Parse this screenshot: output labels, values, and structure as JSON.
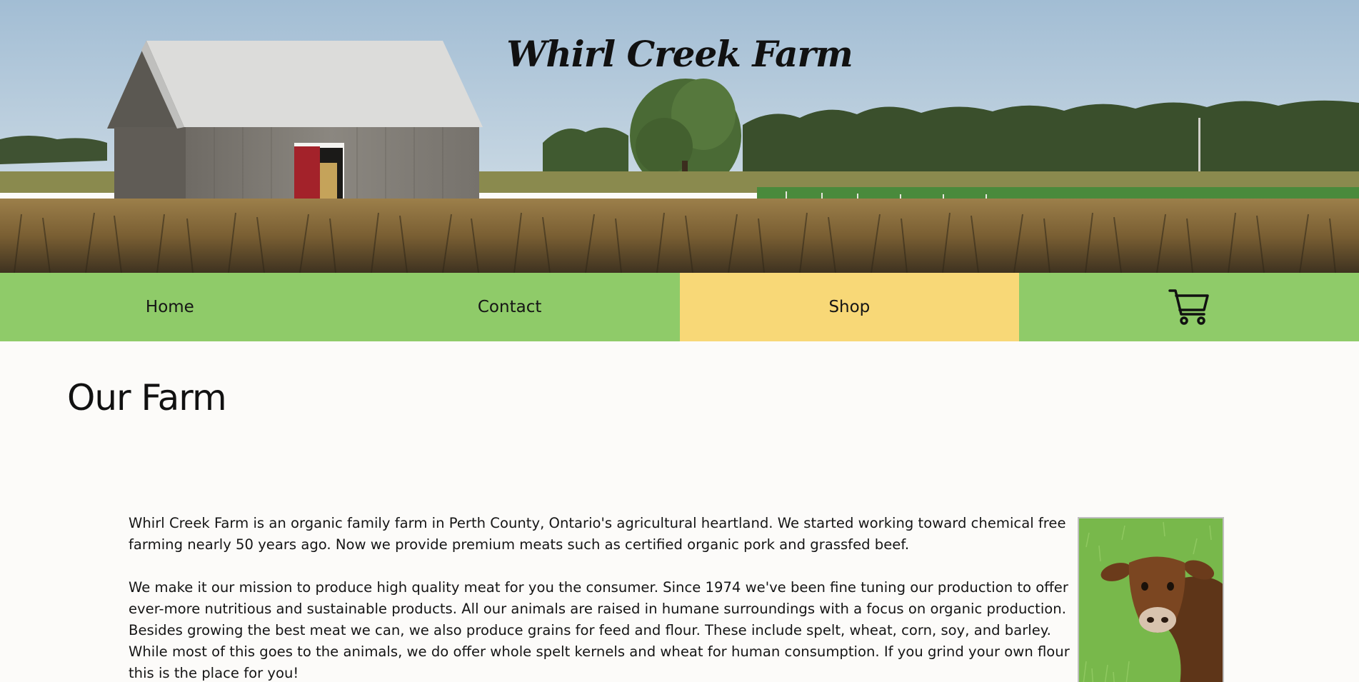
{
  "site": {
    "title": "Whirl Creek Farm"
  },
  "nav": {
    "items": [
      {
        "label": "Home",
        "active": false
      },
      {
        "label": "Contact",
        "active": false
      },
      {
        "label": "Shop",
        "active": true
      }
    ],
    "cart_icon": "cart-icon"
  },
  "main": {
    "heading": "Our Farm",
    "paragraphs": [
      "Whirl Creek Farm is an organic family farm in Perth County, Ontario's agricultural heartland. We started working toward chemical free farming  nearly 50 years ago. Now we provide premium meats such as certified organic pork and grassfed beef.",
      "We make it our mission to produce high quality meat for you the consumer. Since 1974 we've been fine tuning our production to offer ever-more nutritious and sustainable products. All our animals are raised in humane surroundings with a focus on organic production. Besides growing the best meat we can, we also produce grains for feed and flour. These include spelt, wheat, corn, soy, and barley. While most of this goes to the animals, we do offer whole spelt kernels and wheat for human consumption. If you grind your own flour this is the place for you!"
    ]
  },
  "colors": {
    "nav_green": "#8fcb69",
    "nav_active_yellow": "#f8d877",
    "page_background": "#fcfbf9"
  }
}
